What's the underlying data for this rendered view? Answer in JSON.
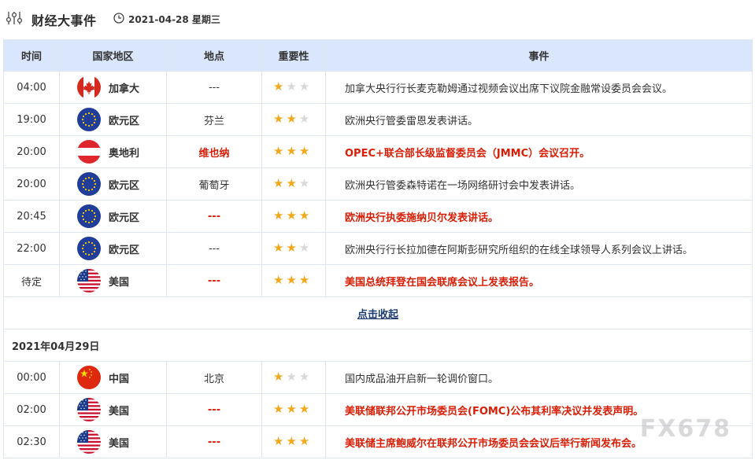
{
  "header": {
    "title": "财经大事件",
    "date": "2021-04-28 星期三"
  },
  "columns": {
    "time": "时间",
    "country": "国家地区",
    "place": "地点",
    "importance": "重要性",
    "event": "事件"
  },
  "rows_day1": [
    {
      "time": "04:00",
      "country": "加拿大",
      "flag": "canada",
      "place": "---",
      "stars": 1,
      "event": "加拿大央行行长麦克勒姆通过视频会议出席下议院金融常设委员会会议。",
      "highlight": false
    },
    {
      "time": "19:00",
      "country": "欧元区",
      "flag": "eu",
      "place": "芬兰",
      "stars": 2,
      "event": "欧洲央行管委雷恩发表讲话。",
      "highlight": false
    },
    {
      "time": "20:00",
      "country": "奥地利",
      "flag": "austria",
      "place": "维也纳",
      "stars": 3,
      "event": "OPEC+联合部长级监督委员会（JMMC）会议召开。",
      "highlight": true
    },
    {
      "time": "20:00",
      "country": "欧元区",
      "flag": "eu",
      "place": "葡萄牙",
      "stars": 2,
      "event": "欧洲央行管委森特诺在一场网络研讨会中发表讲话。",
      "highlight": false
    },
    {
      "time": "20:45",
      "country": "欧元区",
      "flag": "eu",
      "place": "---",
      "stars": 3,
      "event": "欧洲央行执委施纳贝尔发表讲话。",
      "highlight": true
    },
    {
      "time": "22:00",
      "country": "欧元区",
      "flag": "eu",
      "place": "---",
      "stars": 2,
      "event": "欧洲央行行长拉加德在阿斯彭研究所组织的在线全球领导人系列会议上讲话。",
      "highlight": false
    },
    {
      "time": "待定",
      "country": "美国",
      "flag": "usa",
      "place": "---",
      "stars": 3,
      "event": "美国总统拜登在国会联席会议上发表报告。",
      "highlight": true
    }
  ],
  "collapse_label": "点击收起",
  "day2_label": "2021年04月29日",
  "rows_day2": [
    {
      "time": "00:00",
      "country": "中国",
      "flag": "china",
      "place": "北京",
      "stars": 1,
      "event": "国内成品油开启新一轮调价窗口。",
      "highlight": false
    },
    {
      "time": "02:00",
      "country": "美国",
      "flag": "usa",
      "place": "---",
      "stars": 3,
      "event": "美联储联邦公开市场委员会(FOMC)公布其利率决议并发表声明。",
      "highlight": true
    },
    {
      "time": "02:30",
      "country": "美国",
      "flag": "usa",
      "place": "---",
      "stars": 3,
      "event": "美联储主席鲍威尔在联邦公开市场委员会会议后举行新闻发布会。",
      "highlight": true
    }
  ],
  "watermark": "FX678",
  "colors": {
    "header_bg": "#d9e6fb",
    "highlight_red": "#d81e06",
    "star_on": "#f3a81c",
    "star_off": "#d8d8d8"
  }
}
